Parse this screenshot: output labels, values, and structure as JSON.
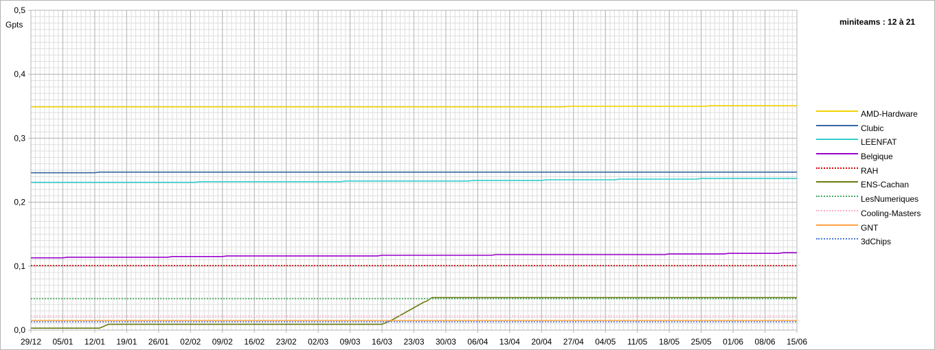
{
  "chart_data": {
    "type": "line",
    "title": "miniteams : 12 à 21",
    "ylabel": "Gpts",
    "ylim": [
      0,
      0.5
    ],
    "y_ticks": [
      "0,0",
      "0,1",
      "0,2",
      "0,3",
      "0,4",
      "0,5"
    ],
    "x_ticks": [
      "29/12",
      "05/01",
      "12/01",
      "19/01",
      "26/01",
      "02/02",
      "09/02",
      "16/02",
      "23/02",
      "02/03",
      "09/03",
      "16/03",
      "23/03",
      "30/03",
      "06/04",
      "13/04",
      "20/04",
      "27/04",
      "04/05",
      "11/05",
      "18/05",
      "25/05",
      "01/06",
      "08/06",
      "15/06"
    ],
    "x_range_days": [
      0,
      168
    ],
    "grid": true,
    "legend_position": "right",
    "series": [
      {
        "name": "AMD-Hardware",
        "color": "#f2d300",
        "dash": "solid",
        "points": [
          [
            0,
            0.349
          ],
          [
            117,
            0.349
          ],
          [
            118,
            0.35
          ],
          [
            148,
            0.35
          ],
          [
            149,
            0.351
          ],
          [
            168,
            0.351
          ]
        ]
      },
      {
        "name": "Clubic",
        "color": "#3465a4",
        "dash": "solid",
        "points": [
          [
            0,
            0.246
          ],
          [
            14,
            0.246
          ],
          [
            15,
            0.247
          ],
          [
            168,
            0.247
          ]
        ]
      },
      {
        "name": "LEENFAT",
        "color": "#33cccc",
        "dash": "solid",
        "points": [
          [
            0,
            0.231
          ],
          [
            36,
            0.231
          ],
          [
            37,
            0.232
          ],
          [
            68,
            0.232
          ],
          [
            69,
            0.233
          ],
          [
            96,
            0.233
          ],
          [
            97,
            0.234
          ],
          [
            112,
            0.234
          ],
          [
            113,
            0.235
          ],
          [
            128,
            0.235
          ],
          [
            129,
            0.236
          ],
          [
            146,
            0.236
          ],
          [
            147,
            0.237
          ],
          [
            168,
            0.237
          ]
        ]
      },
      {
        "name": "Belgique",
        "color": "#9900cc",
        "dash": "solid",
        "points": [
          [
            0,
            0.113
          ],
          [
            7,
            0.113
          ],
          [
            8,
            0.114
          ],
          [
            30,
            0.114
          ],
          [
            31,
            0.115
          ],
          [
            42,
            0.115
          ],
          [
            43,
            0.116
          ],
          [
            76,
            0.116
          ],
          [
            77,
            0.117
          ],
          [
            101,
            0.117
          ],
          [
            102,
            0.118
          ],
          [
            139,
            0.118
          ],
          [
            140,
            0.119
          ],
          [
            152,
            0.119
          ],
          [
            153,
            0.12
          ],
          [
            164,
            0.12
          ],
          [
            165,
            0.121
          ],
          [
            168,
            0.121
          ]
        ]
      },
      {
        "name": "RAH",
        "color": "#dd0000",
        "dash": "dotted",
        "points": [
          [
            0,
            0.101
          ],
          [
            168,
            0.101
          ]
        ]
      },
      {
        "name": "ENS-Cachan",
        "color": "#6b7a0f",
        "dash": "solid",
        "points": [
          [
            0,
            0.003
          ],
          [
            15,
            0.003
          ],
          [
            17,
            0.009
          ],
          [
            77,
            0.009
          ],
          [
            79,
            0.015
          ],
          [
            86,
            0.043
          ],
          [
            87,
            0.046
          ],
          [
            88,
            0.051
          ],
          [
            168,
            0.051
          ]
        ]
      },
      {
        "name": "LesNumeriques",
        "color": "#3caa5a",
        "dash": "dotted",
        "points": [
          [
            0,
            0.049
          ],
          [
            168,
            0.049
          ]
        ]
      },
      {
        "name": "Cooling-Masters",
        "color": "#ffaacc",
        "dash": "dotted",
        "points": [
          [
            0,
            0.022
          ],
          [
            168,
            0.022
          ]
        ]
      },
      {
        "name": "GNT",
        "color": "#ffa040",
        "dash": "solid",
        "points": [
          [
            0,
            0.015
          ],
          [
            168,
            0.015
          ]
        ]
      },
      {
        "name": "3dChips",
        "color": "#4477dd",
        "dash": "dotted",
        "points": [
          [
            0,
            0.013
          ],
          [
            168,
            0.013
          ]
        ]
      }
    ]
  }
}
